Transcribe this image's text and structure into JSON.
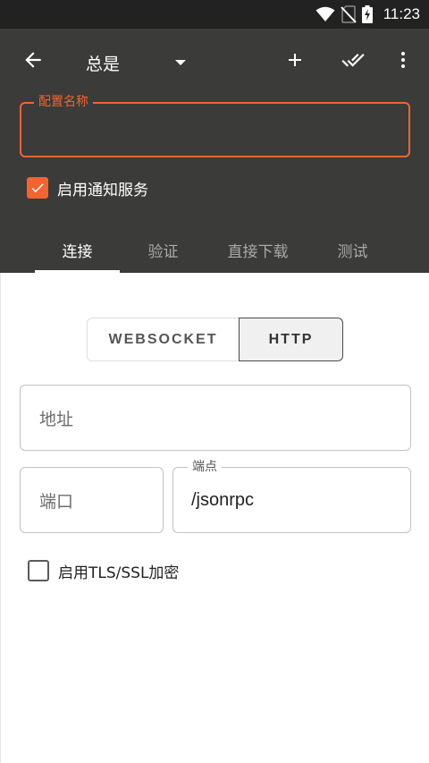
{
  "status_bar": {
    "time": "11:23",
    "icons": [
      "wifi-icon",
      "no-sim-icon",
      "battery-charging-icon"
    ]
  },
  "toolbar": {
    "back_icon": "arrow-left-icon",
    "spinner_value": "总是",
    "add_icon": "plus-icon",
    "done_all_icon": "double-check-icon",
    "more_icon": "more-vertical-icon"
  },
  "profile": {
    "name_label": "配置名称",
    "name_value": "",
    "notify_label": "启用通知服务",
    "notify_checked": true
  },
  "tabs": [
    {
      "label": "连接",
      "active": true
    },
    {
      "label": "验证",
      "active": false
    },
    {
      "label": "直接下载",
      "active": false
    },
    {
      "label": "测试",
      "active": false
    }
  ],
  "connection": {
    "type_options": [
      "WEBSOCKET",
      "HTTP"
    ],
    "selected_type": "HTTP",
    "address_placeholder": "地址",
    "port_placeholder": "端口",
    "endpoint_label": "端点",
    "endpoint_value": "/jsonrpc",
    "tls_label": "启用TLS/SSL加密",
    "tls_checked": false
  },
  "colors": {
    "accent": "#f26430",
    "appbar": "#3b3b3a",
    "statusbar": "#222222"
  }
}
